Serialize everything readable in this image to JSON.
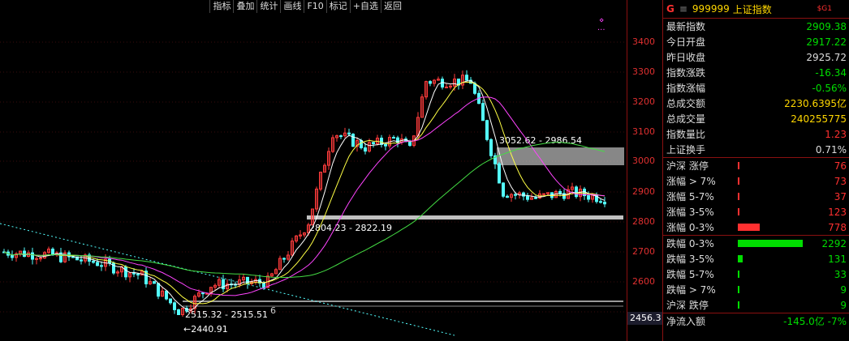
{
  "toolbar": [
    "指标",
    "叠加",
    "统计",
    "画线",
    "F10",
    "标记",
    "+自选",
    "返回"
  ],
  "axis": {
    "ticks": [
      "3400",
      "3300",
      "3200",
      "3100",
      "3000",
      "2900",
      "2800",
      "2700",
      "2600"
    ],
    "current_label": "2456.3"
  },
  "annotations": {
    "upper_zone": "3052.62 - 2986.54",
    "lower_zone": "2804.23 - 2822.19",
    "bottom_zone": "2515.32 - 2515.51",
    "bottom_suffix": "6",
    "low_point": "←2440.91"
  },
  "header": {
    "logo": "G",
    "menu": "≡",
    "code": "999999",
    "name": "上证指数",
    "tag": "$G1"
  },
  "stats": [
    {
      "label": "最新指数",
      "value": "2909.38",
      "color": "#00dd00"
    },
    {
      "label": "今日开盘",
      "value": "2917.22",
      "color": "#00dd00"
    },
    {
      "label": "昨日收盘",
      "value": "2925.72",
      "color": "#dddddd"
    },
    {
      "label": "指数涨跌",
      "value": "-16.34",
      "color": "#00dd00"
    },
    {
      "label": "指数涨幅",
      "value": "-0.56%",
      "color": "#00dd00"
    },
    {
      "label": "总成交额",
      "value": "2230.6395亿",
      "color": "#ffd700"
    },
    {
      "label": "总成交量",
      "value": "240255775",
      "color": "#ffd700"
    },
    {
      "label": "指数量比",
      "value": "1.23",
      "color": "#ff3030"
    },
    {
      "label": "上证换手",
      "value": "0.71%",
      "color": "#dddddd"
    }
  ],
  "up_rows": [
    {
      "label": "沪深 涨停",
      "value": "76",
      "fill": 0.01
    },
    {
      "label": "涨幅 > 7%",
      "value": "73",
      "fill": 0.01
    },
    {
      "label": "涨幅 5-7%",
      "value": "37",
      "fill": 0.005
    },
    {
      "label": "涨幅 3-5%",
      "value": "123",
      "fill": 0.02
    },
    {
      "label": "涨幅 0-3%",
      "value": "778",
      "fill": 0.34
    }
  ],
  "down_rows": [
    {
      "label": "跌幅 0-3%",
      "value": "2292",
      "fill": 1.0
    },
    {
      "label": "跌幅 3-5%",
      "value": "131",
      "fill": 0.07
    },
    {
      "label": "跌幅 5-7%",
      "value": "33",
      "fill": 0.005
    },
    {
      "label": "跌幅 > 7%",
      "value": "9",
      "fill": 0.005
    },
    {
      "label": "沪深 跌停",
      "value": "9",
      "fill": 0.005
    }
  ],
  "net_flow": {
    "label": "净流入额",
    "value": "-145.0亿 -7%"
  },
  "colors": {
    "up": "#ff3030",
    "down": "#00dd00",
    "accent": "#ffd700",
    "cyan": "#54ffff"
  }
}
